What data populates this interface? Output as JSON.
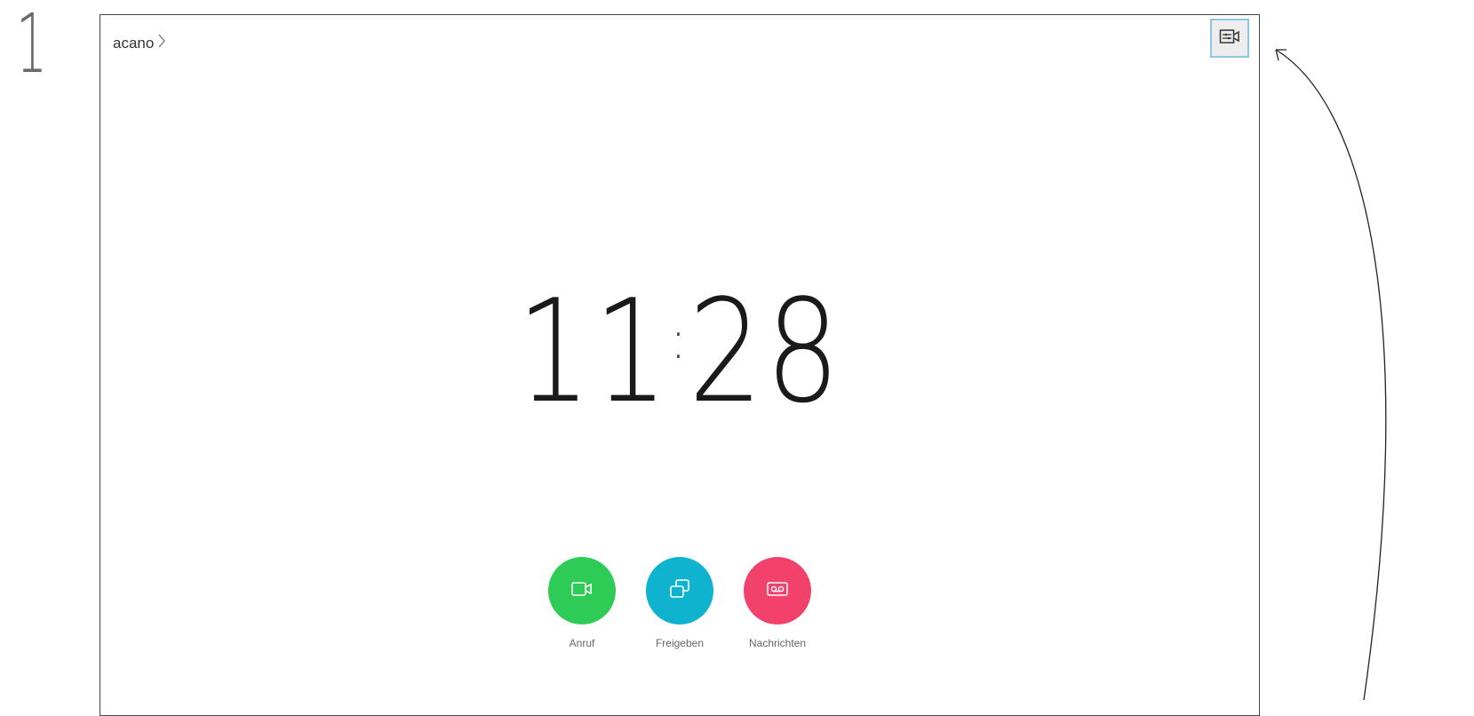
{
  "step": "1",
  "header": {
    "name": "acano",
    "chevron": "›"
  },
  "clock": {
    "hours": "11",
    "separator": ":",
    "minutes": "28"
  },
  "actions": [
    {
      "label": "Anruf",
      "icon": "video-camera-icon",
      "color": "#2fcb57"
    },
    {
      "label": "Freigeben",
      "icon": "share-screen-icon",
      "color": "#0fb3cf"
    },
    {
      "label": "Nachrichten",
      "icon": "voicemail-icon",
      "color": "#f2416a"
    }
  ],
  "camera_button": {
    "icon": "camera-control-icon"
  }
}
